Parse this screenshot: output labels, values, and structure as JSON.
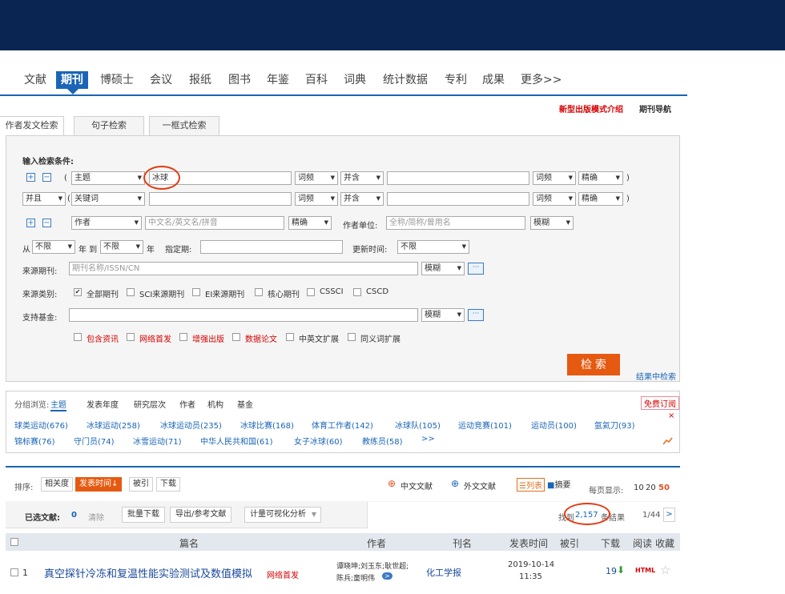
{
  "nav": {
    "tabs": [
      "文献",
      "期刊",
      "博硕士",
      "会议",
      "报纸",
      "图书",
      "年鉴",
      "百科",
      "词典",
      "统计数据",
      "专利",
      "成果",
      "更多>>"
    ],
    "active": "期刊"
  },
  "links": {
    "new_mode": "新型出版模式介绍",
    "journal_nav": "期刊导航"
  },
  "search_tabs": [
    "作者发文检索",
    "句子检索",
    "一框式检索"
  ],
  "form": {
    "title": "输入检索条件:",
    "row1": {
      "open": "(",
      "field": "主题",
      "value": "冰球",
      "freq": "词频",
      "op": "并含",
      "freq2": "词频",
      "match": "精确",
      "close": ")"
    },
    "row2": {
      "logic": "并且",
      "open": "(",
      "field": "关键词",
      "value": "",
      "freq": "词频",
      "op": "并含",
      "freq2": "词频",
      "match": "精确",
      "close": ")"
    },
    "row3": {
      "field": "作者",
      "author_ph": "中文名/英文名/拼音",
      "match": "精确",
      "unit_label": "作者单位:",
      "unit_ph": "全称/简称/曾用名",
      "match2": "模糊"
    },
    "row4": {
      "from_label": "从",
      "from": "不限",
      "year1": "年 到",
      "to": "不限",
      "year2": "年",
      "spec_label": "指定期:",
      "update_label": "更新时间:",
      "update": "不限"
    },
    "source_label": "来源期刊:",
    "source_ph": "期刊名称/ISSN/CN",
    "source_match": "模糊",
    "category_label": "来源类别:",
    "categories": [
      "全部期刊",
      "SCI来源期刊",
      "EI来源期刊",
      "核心期刊",
      "CSSCI",
      "CSCD"
    ],
    "fund_label": "支持基金:",
    "fund_match": "模糊",
    "options": [
      "包含资讯",
      "网络首发",
      "增强出版",
      "数据论文",
      "中英文扩展",
      "同义词扩展"
    ],
    "search_button": "检 索",
    "in_results": "结果中检索"
  },
  "group": {
    "label": "分组浏览:",
    "tabs": [
      "主题",
      "发表年度",
      "研究层次",
      "作者",
      "机构",
      "基金"
    ],
    "subscribe": "免费订阅",
    "row1": [
      "球类运动(676)",
      "冰球运动(258)",
      "冰球运动员(235)",
      "冰球比赛(168)",
      "体育工作者(142)",
      "冰球队(105)",
      "运动竞赛(101)",
      "运动员(100)",
      "氩氦刀(93)"
    ],
    "row2": [
      "锦标赛(76)",
      "守门员(74)",
      "冰雪运动(71)",
      "中华人民共和国(61)",
      "女子冰球(60)",
      "教练员(58)",
      ">>"
    ],
    "close": "×"
  },
  "results": {
    "sort_label": "排序:",
    "sort": [
      "相关度",
      "发表时间↓",
      "被引",
      "下载"
    ],
    "zh": "中文文献",
    "wai": "外文文献",
    "view_list": "列表",
    "view_abs": "摘要",
    "per_page_label": "每页显示:",
    "per_page": [
      "10",
      "20",
      "50"
    ],
    "selected_label": "已选文献:",
    "selected_count": "0",
    "clear": "清除",
    "batch": "批量下载",
    "export": "导出/参考文献",
    "visual": "计量可视化分析",
    "found_prefix": "找到",
    "found_count": "2,157",
    "found_suffix": "条结果",
    "page": "1/44",
    "next": ">",
    "headers": [
      "篇名",
      "作者",
      "刊名",
      "发表时间",
      "被引",
      "下载",
      "阅读",
      "收藏"
    ],
    "rows": [
      {
        "no": "1",
        "title": "真空探针冷冻和复温性能实验测试及数值模拟",
        "badge": "网络首发",
        "authors1": "谭晓坤;刘玉东;耿世超;",
        "authors2": "陈兵;童明伟",
        "more": ">",
        "journal": "化工学报",
        "date1": "2019-10-14",
        "date2": "11:35",
        "cited": "",
        "downloads": "19",
        "read": "HTML"
      }
    ]
  }
}
